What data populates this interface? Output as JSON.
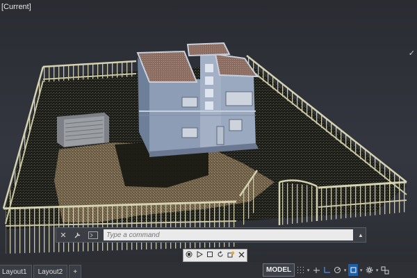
{
  "viewport": {
    "label": "[Current]"
  },
  "command_line": {
    "close_icon": "✕",
    "settings_icon": "wrench",
    "prompt_icon": "prompt",
    "placeholder": "Type a command",
    "expand_icon": "▲"
  },
  "minibar": {
    "icons": [
      "pan-icon",
      "play-icon",
      "stop-icon",
      "rotate-icon",
      "orbit-icon",
      "close-icon"
    ]
  },
  "layout_tabs": {
    "tab1": "Layout1",
    "tab2": "Layout2",
    "add": "+"
  },
  "status_bar": {
    "model_label": "MODEL",
    "colors": {
      "active": "#1f5fa8"
    }
  },
  "colors": {
    "background": "#2b2d33",
    "lawn": "#1c1d17",
    "gravel": "#8a7a62",
    "building": "#8f9fb8",
    "roof": "#9a7e72",
    "fence": "#c8c6a4"
  }
}
